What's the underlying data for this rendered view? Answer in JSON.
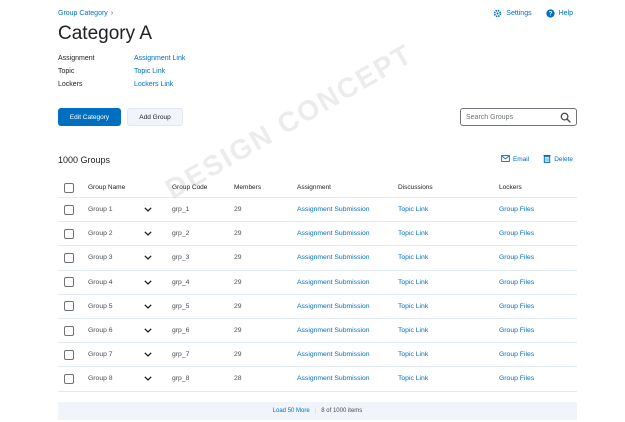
{
  "breadcrumb": {
    "label": "Group Category"
  },
  "toolbar": {
    "settings_label": "Settings",
    "help_label": "Help"
  },
  "page": {
    "title": "Category A"
  },
  "meta": [
    {
      "key": "Assignment",
      "value": "Assignment Link"
    },
    {
      "key": "Topic",
      "value": "Topic Link"
    },
    {
      "key": "Lockers",
      "value": "Lockers Link"
    }
  ],
  "buttons": {
    "edit_category": "Edit Category",
    "add_group": "Add Group"
  },
  "search": {
    "placeholder": "Search Groups"
  },
  "list": {
    "count_label": "1000 Groups",
    "email_label": "Email",
    "delete_label": "Delete"
  },
  "watermark": "DESIGN CONCEPT",
  "table": {
    "headers": {
      "name": "Group Name",
      "code": "Group Code",
      "members": "Members",
      "assignment": "Assignment",
      "discussions": "Discussions",
      "lockers": "Lockers"
    },
    "rows": [
      {
        "name": "Group 1",
        "code": "grp_1",
        "members": "29",
        "assignment": "Assignment Submission",
        "discussions": "Topic Link",
        "lockers": "Group Files"
      },
      {
        "name": "Group 2",
        "code": "grp_2",
        "members": "29",
        "assignment": "Assignment Submission",
        "discussions": "Topic Link",
        "lockers": "Group Files"
      },
      {
        "name": "Group 3",
        "code": "grp_3",
        "members": "29",
        "assignment": "Assignment Submission",
        "discussions": "Topic Link",
        "lockers": "Group Files"
      },
      {
        "name": "Group 4",
        "code": "grp_4",
        "members": "29",
        "assignment": "Assignment Submission",
        "discussions": "Topic Link",
        "lockers": "Group Files"
      },
      {
        "name": "Group 5",
        "code": "grp_5",
        "members": "29",
        "assignment": "Assignment Submission",
        "discussions": "Topic Link",
        "lockers": "Group Files"
      },
      {
        "name": "Group 6",
        "code": "grp_6",
        "members": "29",
        "assignment": "Assignment Submission",
        "discussions": "Topic Link",
        "lockers": "Group Files"
      },
      {
        "name": "Group 7",
        "code": "grp_7",
        "members": "29",
        "assignment": "Assignment Submission",
        "discussions": "Topic Link",
        "lockers": "Group Files"
      },
      {
        "name": "Group 8",
        "code": "grp_8",
        "members": "28",
        "assignment": "Assignment Submission",
        "discussions": "Topic Link",
        "lockers": "Group Files"
      }
    ]
  },
  "footer": {
    "load_label": "Load",
    "load_count": "50 More",
    "status": "8 of 1000 items"
  },
  "colors": {
    "accent": "#006fbf",
    "text": "#202122",
    "muted": "#494c4e",
    "border": "#e3e9f1"
  }
}
